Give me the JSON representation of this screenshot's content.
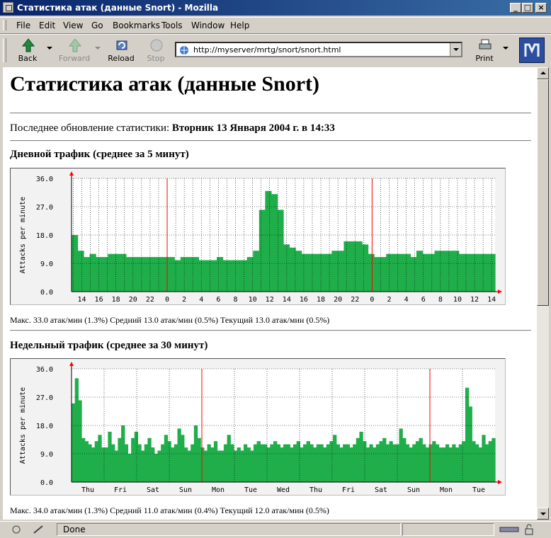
{
  "window": {
    "title": "Статистика атак (данные Snort) - Mozilla"
  },
  "menu": [
    "File",
    "Edit",
    "View",
    "Go",
    "Bookmarks",
    "Tools",
    "Window",
    "Help"
  ],
  "toolbar": {
    "back": "Back",
    "forward": "Forward",
    "reload": "Reload",
    "stop": "Stop",
    "print": "Print"
  },
  "url": "http://myserver/mrtg/snort/snort.html",
  "page": {
    "heading": "Статистика атак (данные Snort)",
    "update_label": "Последнее обновление статистики:",
    "update_value": "Вторник 13 Января 2004 г. в 14:33",
    "daily_title": "Дневной трафик (среднее за 5 минут)",
    "daily_stats": "Макс. 33.0 атак/мин (1.3%)  Средний 13.0 атак/мин (0.5%)  Текущий 13.0 атак/мин (0.5%)",
    "weekly_title": "Недельный трафик (среднее за 30 минут)",
    "weekly_stats": "Макс. 34.0 атак/мин (1.3%)  Средний 11.0 атак/мин (0.4%)  Текущий 12.0 атак/мин (0.5%)"
  },
  "status": {
    "text": "Done"
  },
  "colors": {
    "fill": "#1fae4a",
    "grid": "#000000",
    "marker": "#ff0000",
    "axis": "#000000",
    "arrow": "#ff0000"
  },
  "chart_data": [
    {
      "type": "bar",
      "ylabel": "Attacks per minute",
      "ylim": [
        0,
        36
      ],
      "yticks": [
        "0.0",
        "9.0",
        "18.0",
        "27.0",
        "36.0"
      ],
      "xticks": [
        "14",
        "16",
        "18",
        "20",
        "22",
        "0",
        "2",
        "4",
        "6",
        "8",
        "10",
        "12",
        "14",
        "16",
        "18",
        "20",
        "22",
        "0",
        "2",
        "4",
        "6",
        "8",
        "10",
        "12",
        "14"
      ],
      "markers_at_tick": [
        5,
        17
      ],
      "x": [
        0,
        1,
        2,
        3,
        4,
        5,
        6,
        7,
        8,
        9,
        10,
        11,
        12,
        13,
        14,
        15,
        16,
        17,
        18,
        19,
        20,
        21,
        22,
        23,
        24,
        25,
        26,
        27,
        28,
        29,
        30,
        31,
        32,
        33,
        34,
        35,
        36,
        37,
        38,
        39,
        40,
        41,
        42,
        43,
        44,
        45,
        46,
        47,
        48
      ],
      "values": [
        18,
        13,
        11,
        12,
        11,
        11,
        12,
        12,
        12,
        11,
        11,
        11,
        11,
        11,
        11,
        11,
        11,
        10,
        11,
        11,
        11,
        10,
        10,
        10,
        11,
        10,
        10,
        10,
        10,
        11,
        13,
        26,
        32,
        31,
        26,
        15,
        14,
        13,
        12,
        12,
        12,
        12,
        12,
        13,
        13,
        16,
        16,
        16,
        15,
        12,
        11,
        11,
        12,
        12,
        12,
        12,
        11,
        13,
        12,
        12,
        13,
        13,
        13,
        13,
        12,
        12,
        12,
        12,
        12,
        12
      ]
    },
    {
      "type": "bar",
      "ylabel": "Attacks per minute",
      "ylim": [
        0,
        36
      ],
      "yticks": [
        "0.0",
        "9.0",
        "18.0",
        "27.0",
        "36.0"
      ],
      "xticks": [
        "Thu",
        "Fri",
        "Sat",
        "Sun",
        "Mon",
        "Tue",
        "Wed",
        "Thu",
        "Fri",
        "Sat",
        "Sun",
        "Mon",
        "Tue"
      ],
      "markers_at_tick": [
        3.5,
        10.5
      ],
      "values": [
        25,
        33,
        26,
        14,
        13,
        12,
        11,
        13,
        15,
        11,
        11,
        16,
        12,
        10,
        14,
        18,
        12,
        9,
        14,
        16,
        12,
        10,
        12,
        14,
        11,
        9,
        10,
        12,
        15,
        13,
        11,
        12,
        17,
        15,
        11,
        10,
        12,
        18,
        14,
        11,
        10,
        12,
        11,
        13,
        10,
        10,
        12,
        15,
        12,
        10,
        11,
        10,
        12,
        11,
        10,
        12,
        13,
        12,
        12,
        11,
        12,
        13,
        12,
        11,
        12,
        12,
        11,
        12,
        13,
        11,
        12,
        13,
        12,
        11,
        12,
        12,
        11,
        12,
        13,
        15,
        12,
        11,
        12,
        12,
        11,
        12,
        14,
        16,
        13,
        11,
        12,
        11,
        12,
        13,
        14,
        12,
        13,
        12,
        12,
        17,
        14,
        12,
        11,
        12,
        13,
        14,
        12,
        11,
        12,
        13,
        12,
        11,
        11,
        12,
        11,
        12,
        11,
        12,
        13,
        30,
        24,
        13,
        12,
        11,
        15,
        12,
        13,
        14
      ]
    }
  ]
}
